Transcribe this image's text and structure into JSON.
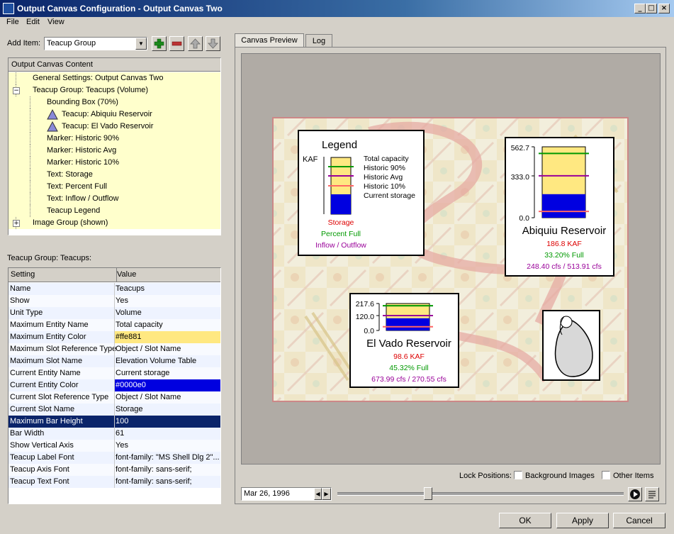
{
  "window": {
    "title": "Output Canvas Configuration - Output Canvas Two"
  },
  "menu": [
    "File",
    "Edit",
    "View"
  ],
  "add_item": {
    "label": "Add Item:",
    "value": "Teacup Group"
  },
  "content_tree": {
    "header": "Output Canvas Content",
    "items": [
      {
        "label": "General Settings: Output Canvas Two",
        "indent": 0,
        "icon": "none"
      },
      {
        "label": "Teacup Group: Teacups (Volume)",
        "indent": 0,
        "icon": "collapse"
      },
      {
        "label": "Bounding Box (70%)",
        "indent": 1,
        "icon": "none"
      },
      {
        "label": "Teacup: Abiquiu Reservoir",
        "indent": 1,
        "icon": "triangle"
      },
      {
        "label": "Teacup: El Vado Reservoir",
        "indent": 1,
        "icon": "triangle"
      },
      {
        "label": "Marker: Historic 90%",
        "indent": 1,
        "icon": "none"
      },
      {
        "label": "Marker: Historic Avg",
        "indent": 1,
        "icon": "none"
      },
      {
        "label": "Marker: Historic 10%",
        "indent": 1,
        "icon": "none"
      },
      {
        "label": "Text: Storage",
        "indent": 1,
        "icon": "none"
      },
      {
        "label": "Text: Percent Full",
        "indent": 1,
        "icon": "none"
      },
      {
        "label": "Text: Inflow / Outflow",
        "indent": 1,
        "icon": "none"
      },
      {
        "label": "Teacup Legend",
        "indent": 1,
        "icon": "none"
      },
      {
        "label": "Image Group (shown)",
        "indent": 0,
        "icon": "expand"
      }
    ]
  },
  "settings": {
    "title": "Teacup Group: Teacups:",
    "col_setting": "Setting",
    "col_value": "Value",
    "rows": [
      {
        "setting": "Name",
        "value": "Teacups"
      },
      {
        "setting": "Show",
        "value": "Yes"
      },
      {
        "setting": "Unit Type",
        "value": "Volume"
      },
      {
        "setting": "Maximum Entity Name",
        "value": "Total capacity"
      },
      {
        "setting": "Maximum Entity Color",
        "value": "#ffe881",
        "swatch": "#ffe881",
        "dark": false
      },
      {
        "setting": "Maximum Slot Reference Type",
        "value": "Object / Slot Name"
      },
      {
        "setting": "Maximum Slot Name",
        "value": "Elevation Volume Table"
      },
      {
        "setting": "Current Entity Name",
        "value": "Current storage"
      },
      {
        "setting": "Current Entity Color",
        "value": "#0000e0",
        "swatch": "#0000e0",
        "dark": true
      },
      {
        "setting": "Current Slot Reference Type",
        "value": "Object / Slot Name"
      },
      {
        "setting": "Current Slot Name",
        "value": "Storage"
      },
      {
        "setting": "Maximum Bar Height",
        "value": "100",
        "selected": true
      },
      {
        "setting": "Bar Width",
        "value": "61"
      },
      {
        "setting": "Show Vertical Axis",
        "value": "Yes"
      },
      {
        "setting": "Teacup Label Font",
        "value": "font-family: \"MS Shell Dlg 2\"..."
      },
      {
        "setting": "Teacup Axis Font",
        "value": "font-family: sans-serif;"
      },
      {
        "setting": "Teacup Text Font",
        "value": "font-family: sans-serif;"
      }
    ]
  },
  "tabs": [
    "Canvas Preview",
    "Log"
  ],
  "legend": {
    "title": "Legend",
    "unit": "KAF",
    "items": [
      "Total capacity",
      "Historic 90%",
      "Historic Avg",
      "Historic 10%",
      "Current storage"
    ],
    "storage": "Storage",
    "percent": "Percent Full",
    "flow": "Inflow / Outflow"
  },
  "teacups": [
    {
      "name": "Abiquiu Reservoir",
      "storage": "186.8 KAF",
      "percent": "33.20% Full",
      "flow": "248.40 cfs / 513.91 cfs",
      "ticks": [
        "562.7",
        "333.0",
        "0.0"
      ],
      "max": 562.7,
      "current": 186.8,
      "h90": 510,
      "avg": 333.0,
      "h10": 50
    },
    {
      "name": "El Vado Reservoir",
      "storage": "98.6 KAF",
      "percent": "45.32% Full",
      "flow": "673.99 cfs / 270.55 cfs",
      "ticks": [
        "217.6",
        "120.0",
        "0.0"
      ],
      "max": 217.6,
      "current": 98.6,
      "h90": 200,
      "avg": 120.0,
      "h10": 30
    }
  ],
  "colors": {
    "capacity": "#ffe881",
    "current": "#0000e0",
    "h90": "#009900",
    "avg": "#990099",
    "h10": "#ff6666",
    "storage_text": "#dd0000",
    "percent_text": "#009900",
    "flow_text": "#990099"
  },
  "lock": {
    "label": "Lock Positions:",
    "bg": "Background Images",
    "other": "Other Items"
  },
  "date": "Mar 26, 1996",
  "buttons": {
    "ok": "OK",
    "apply": "Apply",
    "cancel": "Cancel"
  }
}
